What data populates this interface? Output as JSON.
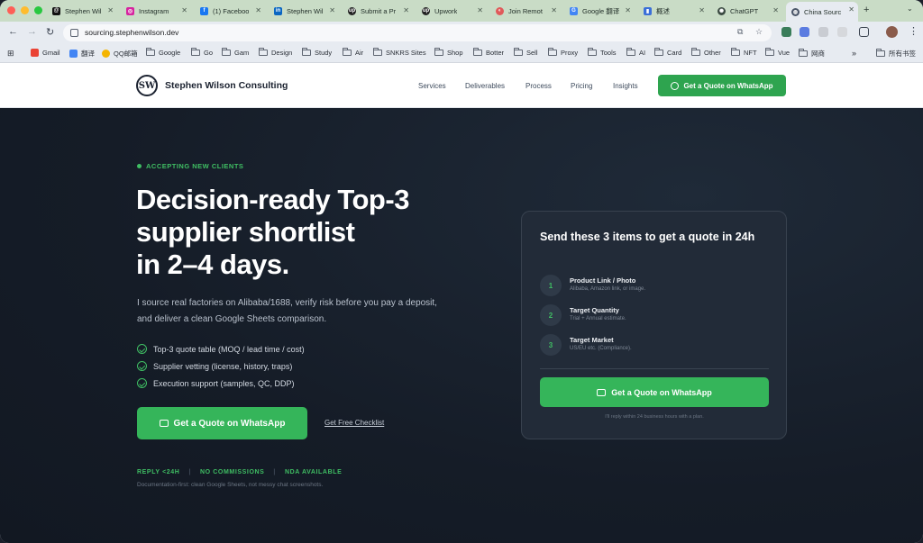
{
  "browser": {
    "tabs": [
      {
        "title": "Stephen Wil",
        "icon": "threads-icon",
        "color": "#111111",
        "active": false
      },
      {
        "title": "Instagram",
        "icon": "instagram-icon",
        "color": "#d6249f",
        "active": false
      },
      {
        "title": "(1) Faceboo",
        "icon": "facebook-icon",
        "color": "#1877f2",
        "active": false
      },
      {
        "title": "Stephen Wil",
        "icon": "linkedin-icon",
        "color": "#0a66c2",
        "active": false
      },
      {
        "title": "Submit a Pr",
        "icon": "upwork-icon",
        "color": "#222222",
        "active": false
      },
      {
        "title": "Upwork",
        "icon": "upwork-icon",
        "color": "#222222",
        "active": false
      },
      {
        "title": "Join Remot",
        "icon": "remote-icon",
        "color": "#e05a5a",
        "active": false
      },
      {
        "title": "Google 翻译",
        "icon": "translate-icon",
        "color": "#4285f4",
        "active": false
      },
      {
        "title": "概述",
        "icon": "chart-icon",
        "color": "#3b6fd8",
        "active": false
      },
      {
        "title": "ChatGPT",
        "icon": "chatgpt-icon",
        "color": "#3b4a42",
        "active": false
      },
      {
        "title": "China Sourc",
        "icon": "globe-icon",
        "color": "#4a5568",
        "active": true
      }
    ],
    "url": "sourcing.stephenwilson.dev",
    "bookmarks": [
      {
        "label": "Gmail",
        "type": "site",
        "color": "#ea4335"
      },
      {
        "label": "翻译",
        "type": "site",
        "color": "#4285f4"
      },
      {
        "label": "QQ邮箱",
        "type": "site",
        "color": "#f4b400"
      },
      {
        "label": "Google",
        "type": "folder"
      },
      {
        "label": "Go",
        "type": "folder"
      },
      {
        "label": "Gam",
        "type": "folder"
      },
      {
        "label": "Design",
        "type": "folder"
      },
      {
        "label": "Study",
        "type": "folder"
      },
      {
        "label": "Air",
        "type": "folder"
      },
      {
        "label": "SNKRS Sites",
        "type": "folder"
      },
      {
        "label": "Shop",
        "type": "folder"
      },
      {
        "label": "Botter",
        "type": "folder"
      },
      {
        "label": "Sell",
        "type": "folder"
      },
      {
        "label": "Proxy",
        "type": "folder"
      },
      {
        "label": "Tools",
        "type": "folder"
      },
      {
        "label": "AI",
        "type": "folder"
      },
      {
        "label": "Card",
        "type": "folder"
      },
      {
        "label": "Other",
        "type": "folder"
      },
      {
        "label": "NFT",
        "type": "folder"
      },
      {
        "label": "Vue",
        "type": "folder"
      },
      {
        "label": "网商",
        "type": "folder"
      }
    ],
    "all_bookmarks": "所有书签"
  },
  "site": {
    "logo_mark": "SW",
    "brand": "Stephen Wilson Consulting",
    "nav": [
      "Services",
      "Deliverables",
      "Process",
      "Pricing",
      "Insights"
    ],
    "header_cta": "Get a Quote on WhatsApp"
  },
  "hero": {
    "badge": "ACCEPTING NEW CLIENTS",
    "headline_lines": [
      "Decision-ready Top-3",
      "supplier shortlist",
      "in 2–4 days."
    ],
    "lede": "I source real factories on Alibaba/1688, verify risk before you pay a deposit, and deliver a clean Google Sheets comparison.",
    "features": [
      "Top-3 quote table (MOQ / lead time / cost)",
      "Supplier vetting (license, history, traps)",
      "Execution support (samples, QC, DDP)"
    ],
    "cta": "Get a Quote on WhatsApp",
    "secondary_link": "Get Free Checklist",
    "meta": [
      "REPLY <24H",
      "NO COMMISSIONS",
      "NDA AVAILABLE"
    ],
    "footnote": "Documentation-first: clean Google Sheets, not messy chat screenshots."
  },
  "card": {
    "title": "Send these 3 items to get a quote in 24h",
    "steps": [
      {
        "num": "1",
        "label": "Product Link / Photo",
        "sub": "Alibaba, Amazon link, or image."
      },
      {
        "num": "2",
        "label": "Target Quantity",
        "sub": "Trial + Annual estimate."
      },
      {
        "num": "3",
        "label": "Target Market",
        "sub": "US/EU etc. (Compliance)."
      }
    ],
    "cta": "Get a Quote on WhatsApp",
    "note": "I'll reply within 24 business hours with a plan."
  },
  "colors": {
    "accent_green": "#35b55a",
    "hero_bg": "#151c27",
    "card_bg": "#222b38"
  }
}
